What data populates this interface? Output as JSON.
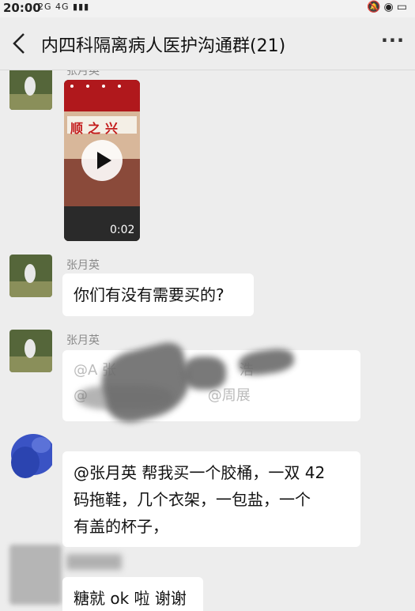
{
  "status_bar": {
    "time": "20:00",
    "network": "2G 4G"
  },
  "header": {
    "title": "内四科隔离病人医护沟通群(21)"
  },
  "messages": [
    {
      "sender": "张月英",
      "type": "video",
      "duration": "0:02",
      "storefront": "顺之兴"
    },
    {
      "sender": "张月英",
      "type": "text",
      "text": "你们有没有需要买的?"
    },
    {
      "sender": "张月英",
      "type": "text",
      "text_top": "@A 张",
      "text_top_right": "浩",
      "text_bottom": "@",
      "text_bottom_mid": "@周展"
    },
    {
      "sender": "",
      "type": "text",
      "lines": [
        "@张月英  帮我买一个胶桶，一双 42",
        "码拖鞋，几个衣架，一包盐，一个",
        "有盖的杯子，"
      ]
    },
    {
      "sender": "",
      "type": "text",
      "text": "糖就 ok 啦 谢谢"
    }
  ],
  "colors": {
    "background": "#ededed",
    "bubble": "#ffffff",
    "name": "#8a8a8a"
  }
}
